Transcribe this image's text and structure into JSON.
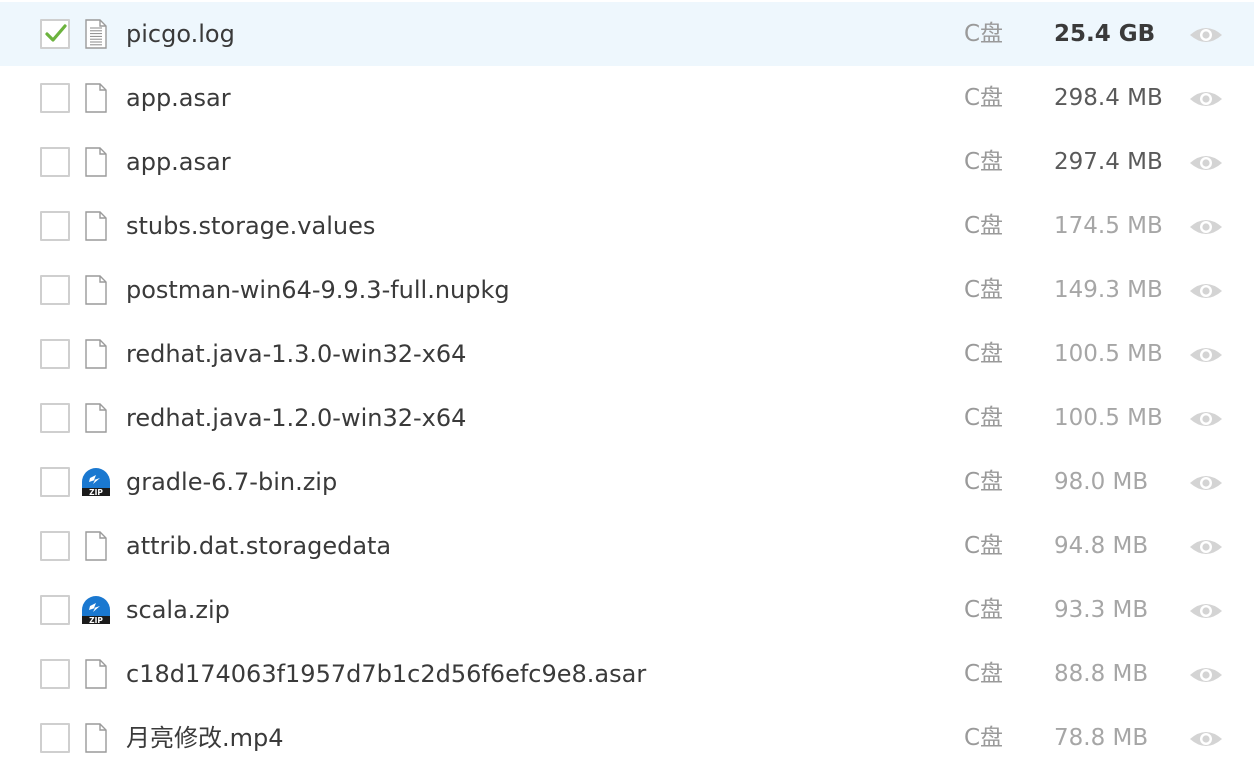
{
  "colors": {
    "selected_row_bg": "#eef7fd",
    "checkmark": "#6cb33e",
    "zip_icon_blue": "#1a78d0",
    "size_dark": "#3a3a3a",
    "size_medium": "#5a5a5a",
    "size_light": "#a6a6a6"
  },
  "files": [
    {
      "name": "picgo.log",
      "drive": "C盘",
      "size": "25.4 GB",
      "icon": "text-file-icon",
      "checked": true,
      "size_style": "bold"
    },
    {
      "name": "app.asar",
      "drive": "C盘",
      "size": "298.4 MB",
      "icon": "file-icon",
      "checked": false,
      "size_style": "dark"
    },
    {
      "name": "app.asar",
      "drive": "C盘",
      "size": "297.4 MB",
      "icon": "file-icon",
      "checked": false,
      "size_style": "dark"
    },
    {
      "name": "stubs.storage.values",
      "drive": "C盘",
      "size": "174.5 MB",
      "icon": "file-icon",
      "checked": false,
      "size_style": "light"
    },
    {
      "name": "postman-win64-9.9.3-full.nupkg",
      "drive": "C盘",
      "size": "149.3 MB",
      "icon": "file-icon",
      "checked": false,
      "size_style": "light"
    },
    {
      "name": "redhat.java-1.3.0-win32-x64",
      "drive": "C盘",
      "size": "100.5 MB",
      "icon": "file-icon",
      "checked": false,
      "size_style": "light"
    },
    {
      "name": "redhat.java-1.2.0-win32-x64",
      "drive": "C盘",
      "size": "100.5 MB",
      "icon": "file-icon",
      "checked": false,
      "size_style": "light"
    },
    {
      "name": "gradle-6.7-bin.zip",
      "drive": "C盘",
      "size": "98.0 MB",
      "icon": "zip-icon",
      "checked": false,
      "size_style": "light"
    },
    {
      "name": "attrib.dat.storagedata",
      "drive": "C盘",
      "size": "94.8 MB",
      "icon": "file-icon",
      "checked": false,
      "size_style": "light"
    },
    {
      "name": "scala.zip",
      "drive": "C盘",
      "size": "93.3 MB",
      "icon": "zip-icon",
      "checked": false,
      "size_style": "light"
    },
    {
      "name": "c18d174063f1957d7b1c2d56f6efc9e8.asar",
      "drive": "C盘",
      "size": "88.8 MB",
      "icon": "file-icon",
      "checked": false,
      "size_style": "light"
    },
    {
      "name": "月亮修改.mp4",
      "drive": "C盘",
      "size": "78.8 MB",
      "icon": "file-icon",
      "checked": false,
      "size_style": "light"
    }
  ]
}
